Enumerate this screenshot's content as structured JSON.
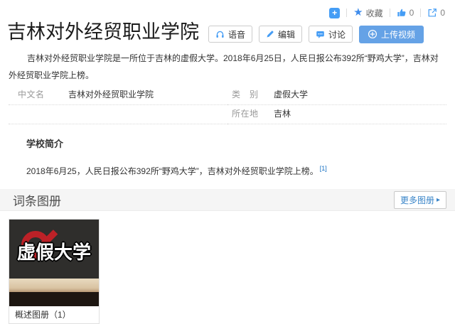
{
  "page": {
    "title": "吉林对外经贸职业学院"
  },
  "header_actions": {
    "app_plus_glyph": "+",
    "collect_label": "收藏",
    "like_count": "0",
    "share_count": "0",
    "star_glyph": "★"
  },
  "toolbar": {
    "voice_label": "语音",
    "edit_label": "编辑",
    "discuss_label": "讨论",
    "upload_label": "上传视频"
  },
  "summary": "吉林对外经贸职业学院是一所位于吉林的虚假大学。2018年6月25日，人民日报公布392所“野鸡大学”，吉林对外经贸职业学院上榜。",
  "infobox": {
    "rows_left": [
      {
        "label": "中文名",
        "value": "吉林对外经贸职业学院"
      }
    ],
    "rows_right": [
      {
        "label": "类别",
        "value": "虚假大学"
      },
      {
        "label": "所在地",
        "value": "吉林"
      }
    ]
  },
  "sections": {
    "intro": {
      "heading": "学校简介",
      "text": "2018年6月25，人民日报公布392所“野鸡大学”，吉林对外经贸职业学院上榜。",
      "ref": "[1]"
    },
    "album": {
      "heading": "词条图册",
      "more_label": "更多图册",
      "arrow_glyph": "▸",
      "card_caption": "概述图册（1）",
      "image_text": "虚假大学"
    }
  },
  "colors": {
    "accent_blue": "#459df5",
    "upload_button_bg": "#65a2e6",
    "link_blue": "#136ec2",
    "more_link_blue": "#3884c8",
    "stamp_red": "#bc2127",
    "album_bar_bg": "#f5f5f5"
  }
}
